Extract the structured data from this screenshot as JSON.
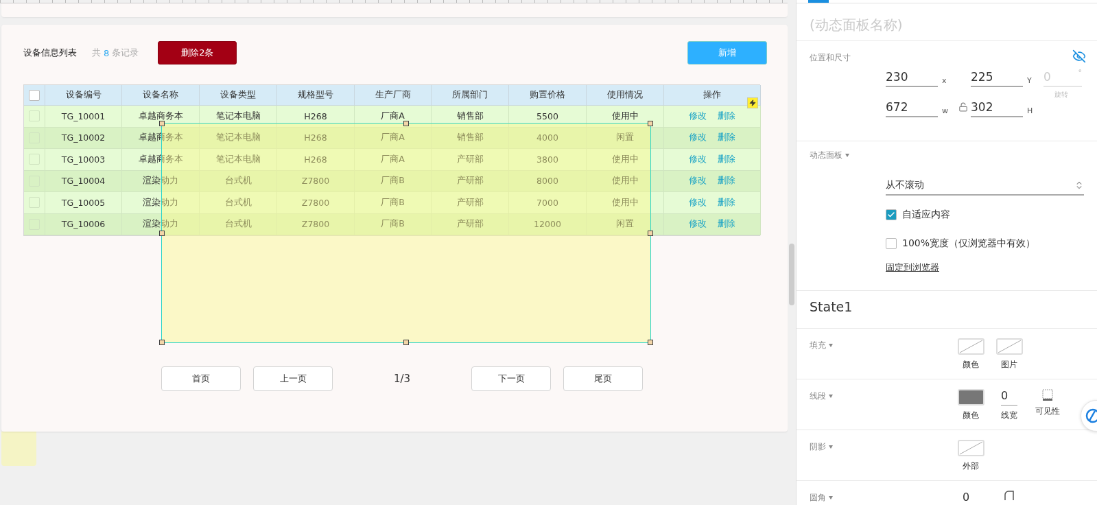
{
  "canvas": {
    "list_title": "设备信息列表",
    "record_count": {
      "prefix": "共",
      "count": "8",
      "suffix": "条记录"
    },
    "delete_button": "删除2条",
    "add_button": "新增",
    "table": {
      "all_checked": false,
      "columns": [
        "设备编号",
        "设备名称",
        "设备类型",
        "规格型号",
        "生产厂商",
        "所属部门",
        "购置价格",
        "使用情况",
        "操作"
      ],
      "rows": [
        {
          "checked": false,
          "cells": [
            "TG_10001",
            "卓越商务本",
            "笔记本电脑",
            "H268",
            "厂商A",
            "销售部",
            "5500",
            "使用中"
          ],
          "actions": [
            "修改",
            "删除"
          ]
        },
        {
          "checked": false,
          "cells": [
            "TG_10002",
            "卓越商务本",
            "笔记本电脑",
            "H268",
            "厂商A",
            "销售部",
            "4000",
            "闲置"
          ],
          "actions": [
            "修改",
            "删除"
          ]
        },
        {
          "checked": false,
          "cells": [
            "TG_10003",
            "卓越商务本",
            "笔记本电脑",
            "H268",
            "厂商A",
            "产研部",
            "3800",
            "使用中"
          ],
          "actions": [
            "修改",
            "删除"
          ]
        },
        {
          "checked": false,
          "cells": [
            "TG_10004",
            "渲染动力",
            "台式机",
            "Z7800",
            "厂商B",
            "产研部",
            "8000",
            "使用中"
          ],
          "actions": [
            "修改",
            "删除"
          ]
        },
        {
          "checked": false,
          "cells": [
            "TG_10005",
            "渲染动力",
            "台式机",
            "Z7800",
            "厂商B",
            "产研部",
            "7000",
            "使用中"
          ],
          "actions": [
            "修改",
            "删除"
          ]
        },
        {
          "checked": false,
          "cells": [
            "TG_10006",
            "渲染动力",
            "台式机",
            "Z7800",
            "厂商B",
            "产研部",
            "12000",
            "闲置"
          ],
          "actions": [
            "修改",
            "删除"
          ]
        }
      ]
    },
    "pagination": {
      "prev": [
        "首页",
        "上一页"
      ],
      "page": "1/3",
      "next": [
        "下一页",
        "尾页"
      ]
    }
  },
  "inspector": {
    "title_placeholder": "(动态面板名称)",
    "position_size": {
      "label": "位置和尺寸",
      "fields": [
        {
          "value": "230",
          "unit": "x",
          "disabled": false
        },
        {
          "value": "225",
          "unit": "Y",
          "disabled": false
        },
        {
          "value": "0",
          "unit": "°",
          "caption": "旋转",
          "disabled": true
        },
        {
          "value": "672",
          "unit": "w",
          "disabled": false
        },
        {
          "value": "302",
          "unit": "H",
          "disabled": false
        }
      ]
    },
    "dynamic_panel": {
      "label": "动态面板",
      "scroll": "从不滚动",
      "options": [
        {
          "label": "自适应内容",
          "checked": true
        },
        {
          "label": "100%宽度（仅浏览器中有效）",
          "checked": false
        }
      ],
      "link": "固定到浏览器"
    },
    "state_name": "State1",
    "style_sections": [
      {
        "label": "填充",
        "items": [
          {
            "kind": "empty_swatch",
            "caption": "颜色"
          },
          {
            "kind": "empty_swatch",
            "caption": "图片"
          }
        ]
      },
      {
        "label": "线段",
        "items": [
          {
            "kind": "filled_swatch",
            "caption": "颜色"
          },
          {
            "kind": "number",
            "value": "0",
            "caption": "线宽"
          },
          {
            "kind": "visibility",
            "caption": "可见性"
          }
        ]
      },
      {
        "label": "阴影",
        "items": [
          {
            "kind": "empty_swatch",
            "caption": "外部"
          }
        ]
      },
      {
        "label": "圆角",
        "items": [
          {
            "kind": "number",
            "value": "0"
          },
          {
            "kind": "corner"
          }
        ]
      }
    ]
  }
}
